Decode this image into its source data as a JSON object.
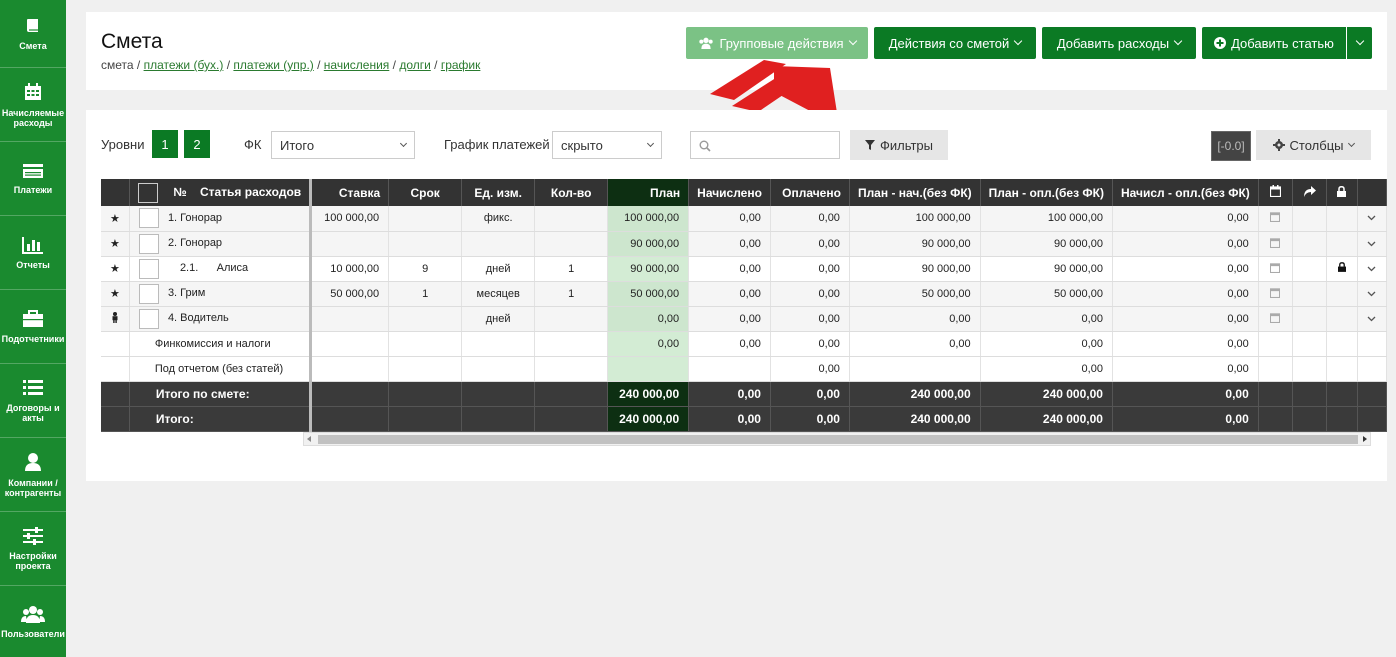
{
  "sidebar": {
    "items": [
      {
        "label": "Смета",
        "icon": "book-icon"
      },
      {
        "label": "Начисляемые расходы",
        "icon": "calendar-icon"
      },
      {
        "label": "Платежи",
        "icon": "card-icon"
      },
      {
        "label": "Отчеты",
        "icon": "bar-chart-icon"
      },
      {
        "label": "Подотчетники",
        "icon": "briefcase-icon"
      },
      {
        "label": "Договоры и акты",
        "icon": "list-icon"
      },
      {
        "label": "Компании / контрагенты",
        "icon": "user-icon"
      },
      {
        "label": "Настройки проекта",
        "icon": "sliders-icon"
      },
      {
        "label": "Пользователи",
        "icon": "users-icon"
      }
    ]
  },
  "header": {
    "title": "Смета",
    "breadcrumb": {
      "first": "смета",
      "links": [
        "платежи (бух.)",
        "платежи (упр.)",
        "начисления",
        "долги",
        "график"
      ]
    },
    "buttons": {
      "group": "Групповые действия",
      "estimate_actions": "Действия со сметой",
      "add_expenses": "Добавить расходы",
      "add_item": "Добавить статью"
    }
  },
  "toolbar": {
    "levels_label": "Уровни",
    "level1": "1",
    "level2": "2",
    "fk_label": "ФК",
    "fk_value": "Итого",
    "schedule_label": "График платежей",
    "schedule_value": "скрыто",
    "filters": "Фильтры",
    "badge": "[-0.0]",
    "columns": "Столбцы"
  },
  "table": {
    "headers": {
      "num": "№",
      "item": "Статья расходов",
      "rate": "Ставка",
      "term": "Срок",
      "unit": "Ед. изм.",
      "qty": "Кол-во",
      "plan": "План",
      "accrued": "Начислено",
      "paid": "Оплачено",
      "plan_acc": "План - нач.(без ФК)",
      "plan_paid": "План - опл.(без ФК)",
      "acc_paid": "Начисл - опл.(без ФК)"
    },
    "rows": [
      {
        "mark": "★",
        "name": "1. Гонорар",
        "rate": "100 000,00",
        "term": "",
        "unit": "фикс.",
        "qty": "",
        "plan": "100 000,00",
        "accrued": "0,00",
        "paid": "0,00",
        "pa": "100 000,00",
        "pp": "100 000,00",
        "ap": "0,00"
      },
      {
        "mark": "★",
        "name": "2. Гонорар",
        "rate": "",
        "term": "",
        "unit": "",
        "qty": "",
        "plan": "90 000,00",
        "accrued": "0,00",
        "paid": "0,00",
        "pa": "90 000,00",
        "pp": "90 000,00",
        "ap": "0,00"
      },
      {
        "mark": "★",
        "name": "2.1.      Алиса",
        "rate": "10 000,00",
        "term": "9",
        "unit": "дней",
        "qty": "1",
        "plan": "90 000,00",
        "accrued": "0,00",
        "paid": "0,00",
        "pa": "90 000,00",
        "pp": "90 000,00",
        "ap": "0,00"
      },
      {
        "mark": "★",
        "name": "3. Грим",
        "rate": "50 000,00",
        "term": "1",
        "unit": "месяцев",
        "qty": "1",
        "plan": "50 000,00",
        "accrued": "0,00",
        "paid": "0,00",
        "pa": "50 000,00",
        "pp": "50 000,00",
        "ap": "0,00"
      },
      {
        "mark": "",
        "name": "4. Водитель",
        "rate": "",
        "term": "",
        "unit": "дней",
        "qty": "",
        "plan": "0,00",
        "accrued": "0,00",
        "paid": "0,00",
        "pa": "0,00",
        "pp": "0,00",
        "ap": "0,00"
      },
      {
        "mark": "",
        "name": "Финкомиссия и налоги",
        "rate": "",
        "term": "",
        "unit": "",
        "qty": "",
        "plan": "0,00",
        "accrued": "0,00",
        "paid": "0,00",
        "pa": "0,00",
        "pp": "0,00",
        "ap": "0,00"
      },
      {
        "mark": "",
        "name": "Под отчетом (без статей)",
        "rate": "",
        "term": "",
        "unit": "",
        "qty": "",
        "plan": "",
        "accrued": "",
        "paid": "0,00",
        "pa": "",
        "pp": "0,00",
        "ap": "0,00"
      }
    ],
    "totals": [
      {
        "name": "Итого по смете:",
        "plan": "240 000,00",
        "accrued": "0,00",
        "paid": "0,00",
        "pa": "240 000,00",
        "pp": "240 000,00",
        "ap": "0,00"
      },
      {
        "name": "Итого:",
        "plan": "240 000,00",
        "accrued": "0,00",
        "paid": "0,00",
        "pa": "240 000,00",
        "pp": "240 000,00",
        "ap": "0,00"
      }
    ]
  },
  "colors": {
    "sidebar": "#1a8a2f",
    "button": "#0b7a24",
    "arrow": "#e02020"
  }
}
